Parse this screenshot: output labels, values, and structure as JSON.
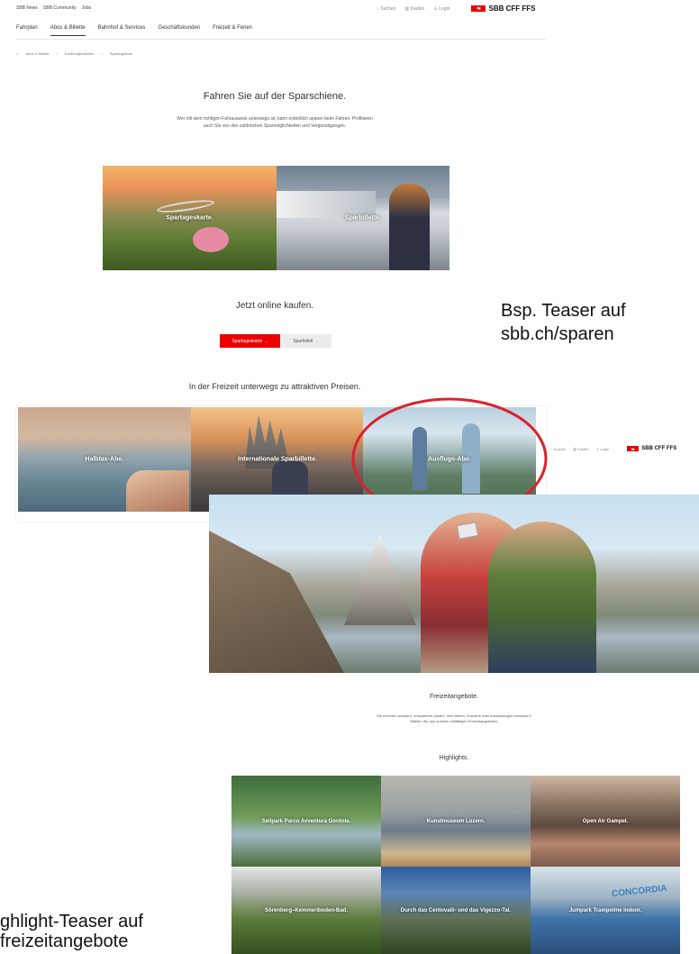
{
  "header": {
    "top_links": [
      "SBB News",
      "SBB Community",
      "Jobs"
    ],
    "nav": [
      "Fahrplan",
      "Abos & Billette",
      "Bahnhof & Services",
      "Geschäftskunden",
      "Freizeit & Ferien"
    ],
    "search": "Suchen",
    "cart": "Kaufen",
    "login": "Login",
    "logo_text": "SBB CFF FFS"
  },
  "breadcrumb": [
    "Abos & Billette",
    "Kaufmöglichkeiten",
    "Sparangebote"
  ],
  "sparen": {
    "title": "Fahren Sie auf der Sparschiene.",
    "lead_line1": "Wer mit dem richtigen Fahrausweis unterwegs ist, kann ordentlich sparen beim Fahren. Profitieren",
    "lead_line2": "auch Sie von den zahlreichen Sparmöglichkeiten und Vergünstigungen.",
    "teasers": [
      "Spartageskarte.",
      "Sparbillette."
    ],
    "buy_title": "Jetzt online kaufen.",
    "btn_primary": "Spartageskarte →",
    "btn_secondary": "Sparbillett →"
  },
  "callout_top": {
    "line1": "Bsp. Teaser auf",
    "line2": "sbb.ch/sparen"
  },
  "freizeit_row": {
    "title": "In der Freizeit unterwegs zu attraktiven Preisen.",
    "teasers": [
      "Halbtax-Abo.",
      "Internationale Sparbillette.",
      "Ausflugs-Abo."
    ]
  },
  "popup_header": {
    "search": "Suchen",
    "cart": "Kaufen",
    "login": "Login",
    "logo_text": "SBB CFF FFS"
  },
  "freizeitangebote": {
    "title": "Freizeitangebote.",
    "lead_line1": "Sie möchten wandern, entspannen, baden, Velo fahren, Konzerte oder Ausstellungen besuchen?",
    "lead_line2": "Wählen Sie aus unseren vielfältigen Freizeitangeboten.",
    "highlights_title": "Highlights.",
    "highlights": [
      "Seilpark Parco Avventura Gordola.",
      "Kunstmuseum Luzern.",
      "Open Air Gampel.",
      "Sörenberg–Kemmeriboden-Bad.",
      "Durch das Centovalli- und das Vigezzo-Tal.",
      "Jumpark Trampoline Indoor."
    ],
    "banner_sign": "CONCORDIA"
  },
  "callout_bottom": {
    "line1": "ghlight-Teaser auf",
    "line2": "freizeitangebote"
  },
  "colors": {
    "sbb_red": "#eb0000",
    "circle_red": "#d9232e"
  }
}
